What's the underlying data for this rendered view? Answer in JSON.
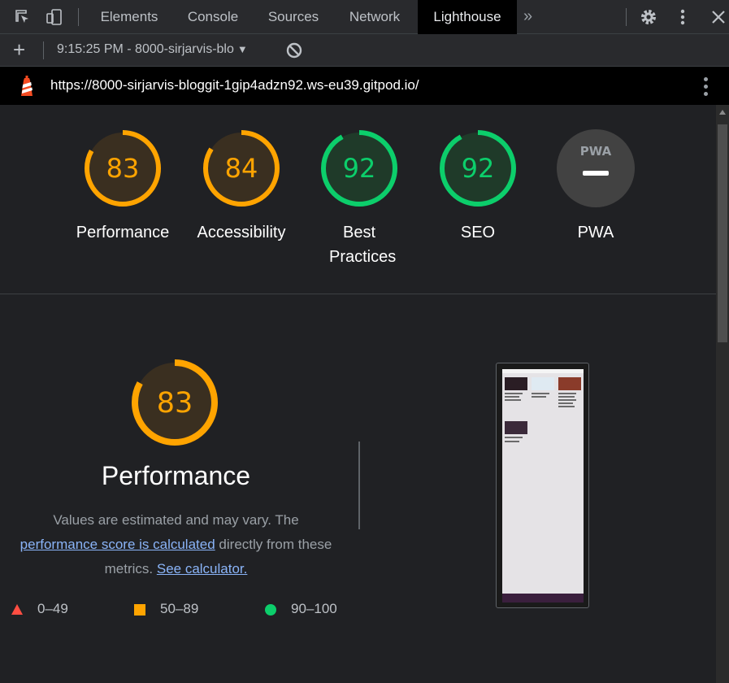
{
  "devtools": {
    "tabs": [
      {
        "label": "Elements"
      },
      {
        "label": "Console"
      },
      {
        "label": "Sources"
      },
      {
        "label": "Network"
      },
      {
        "label": "Lighthouse"
      }
    ],
    "more_tabs_glyph": "»"
  },
  "toolbar": {
    "add_glyph": "+",
    "report_label": "9:15:25 PM - 8000-sirjarvis-blo",
    "caret": "▼"
  },
  "url": "https://8000-sirjarvis-bloggit-1gip4adzn92.ws-eu39.gitpod.io/",
  "colors": {
    "average": "#ffa400",
    "pass": "#0cce6b",
    "fail": "#ff4e42",
    "average_bg": "#3a2f20",
    "pass_bg": "#1f3a29",
    "pwa_bg": "#424242"
  },
  "gauges": [
    {
      "score": "83",
      "label": "Performance",
      "status": "average"
    },
    {
      "score": "84",
      "label": "Accessibility",
      "status": "average"
    },
    {
      "score": "92",
      "label": "Best Practices",
      "status": "pass"
    },
    {
      "score": "92",
      "label": "SEO",
      "status": "pass"
    },
    {
      "score": "PWA",
      "label": "PWA",
      "status": "pwa"
    }
  ],
  "performance": {
    "score": "83",
    "title": "Performance",
    "desc_1": "Values are estimated and may vary. The",
    "link_1": "performance score is calculated",
    "desc_2": "directly from these",
    "desc_3": "metrics.",
    "link_2": "See calculator."
  },
  "legend": [
    {
      "shape": "triangle",
      "range": "0–49",
      "status": "fail"
    },
    {
      "shape": "square",
      "range": "50–89",
      "status": "average"
    },
    {
      "shape": "circle",
      "range": "90–100",
      "status": "pass"
    }
  ]
}
